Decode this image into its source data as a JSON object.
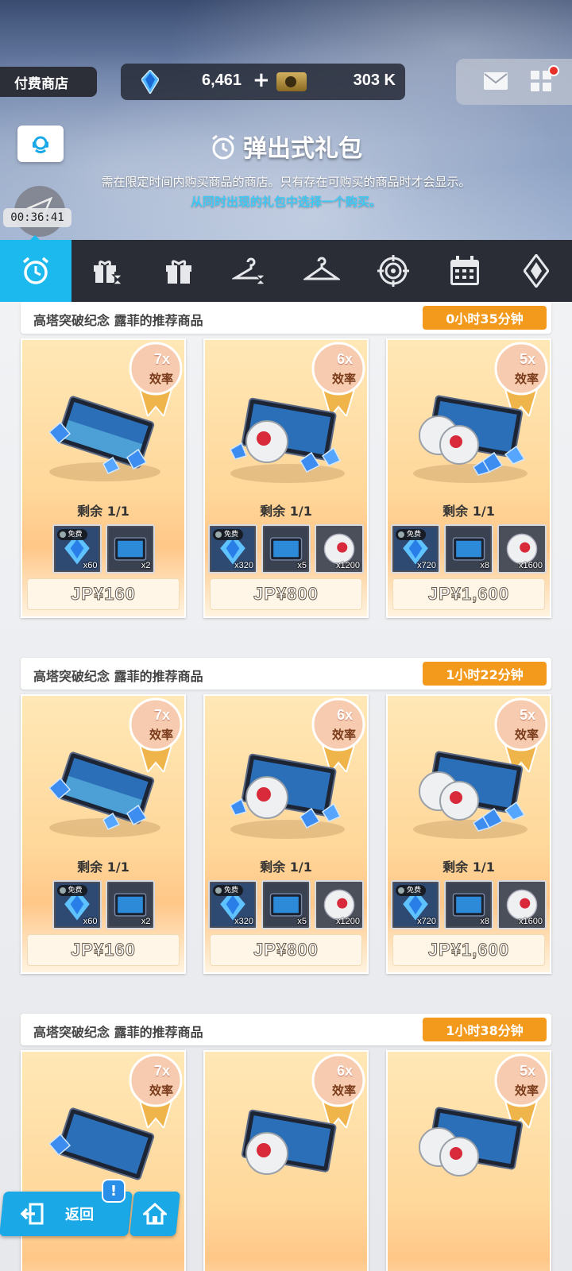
{
  "header": {
    "shop_label": "付费商店",
    "gems": "6,461",
    "gems_plus": "+",
    "credits": "303 K",
    "title": "弹出式礼包",
    "description": "需在限定时间内购买商品的商店。只有存在可购买的商品时才会显示。",
    "hint": "从同时出现的礼包中选择一个购买。",
    "recording_timer": "00:36:41"
  },
  "tabs": [
    {
      "icon": "alarm-clock-icon",
      "active": true
    },
    {
      "icon": "gift-hourglass-icon",
      "active": false
    },
    {
      "icon": "gift-icon",
      "active": false
    },
    {
      "icon": "hanger-hourglass-icon",
      "active": false
    },
    {
      "icon": "hanger-icon",
      "active": false
    },
    {
      "icon": "target-icon",
      "active": false
    },
    {
      "icon": "calendar-icon",
      "active": false
    },
    {
      "icon": "diamond-icon",
      "active": false
    }
  ],
  "groups": [
    {
      "title": "高塔突破纪念 露菲的推荐商品",
      "timer": "0小时35分钟",
      "cards": [
        {
          "multiplier": "7x",
          "efficiency": "效率",
          "remaining": "剩余 1/1",
          "price": "JP¥160",
          "items": [
            {
              "type": "gem",
              "qty": "x60",
              "free": "免费"
            },
            {
              "type": "ticket",
              "qty": "x2"
            }
          ]
        },
        {
          "multiplier": "6x",
          "efficiency": "效率",
          "remaining": "剩余 1/1",
          "price": "JP¥800",
          "items": [
            {
              "type": "gem",
              "qty": "x320",
              "free": "免费"
            },
            {
              "type": "ticket",
              "qty": "x5"
            },
            {
              "type": "orb",
              "qty": "x1200"
            }
          ]
        },
        {
          "multiplier": "5x",
          "efficiency": "效率",
          "remaining": "剩余 1/1",
          "price": "JP¥1,600",
          "items": [
            {
              "type": "gem",
              "qty": "x720",
              "free": "免费"
            },
            {
              "type": "ticket",
              "qty": "x8"
            },
            {
              "type": "orb",
              "qty": "x1600"
            }
          ]
        }
      ]
    },
    {
      "title": "高塔突破纪念 露菲的推荐商品",
      "timer": "1小时22分钟",
      "cards": [
        {
          "multiplier": "7x",
          "efficiency": "效率",
          "remaining": "剩余 1/1",
          "price": "JP¥160",
          "items": [
            {
              "type": "gem",
              "qty": "x60",
              "free": "免费"
            },
            {
              "type": "ticket",
              "qty": "x2"
            }
          ]
        },
        {
          "multiplier": "6x",
          "efficiency": "效率",
          "remaining": "剩余 1/1",
          "price": "JP¥800",
          "items": [
            {
              "type": "gem",
              "qty": "x320",
              "free": "免费"
            },
            {
              "type": "ticket",
              "qty": "x5"
            },
            {
              "type": "orb",
              "qty": "x1200"
            }
          ]
        },
        {
          "multiplier": "5x",
          "efficiency": "效率",
          "remaining": "剩余 1/1",
          "price": "JP¥1,600",
          "items": [
            {
              "type": "gem",
              "qty": "x720",
              "free": "免费"
            },
            {
              "type": "ticket",
              "qty": "x8"
            },
            {
              "type": "orb",
              "qty": "x1600"
            }
          ]
        }
      ]
    },
    {
      "title": "高塔突破纪念 露菲的推荐商品",
      "timer": "1小时38分钟",
      "cards": [
        {
          "multiplier": "7x",
          "efficiency": "效率"
        },
        {
          "multiplier": "6x",
          "efficiency": "效率"
        },
        {
          "multiplier": "5x",
          "efficiency": "效率"
        }
      ]
    }
  ],
  "bottom": {
    "back_label": "返回",
    "alert": "!"
  },
  "colors": {
    "accent": "#1cb9ee",
    "timer_orange": "#f39a1c",
    "tabbar": "#2a2d35"
  }
}
